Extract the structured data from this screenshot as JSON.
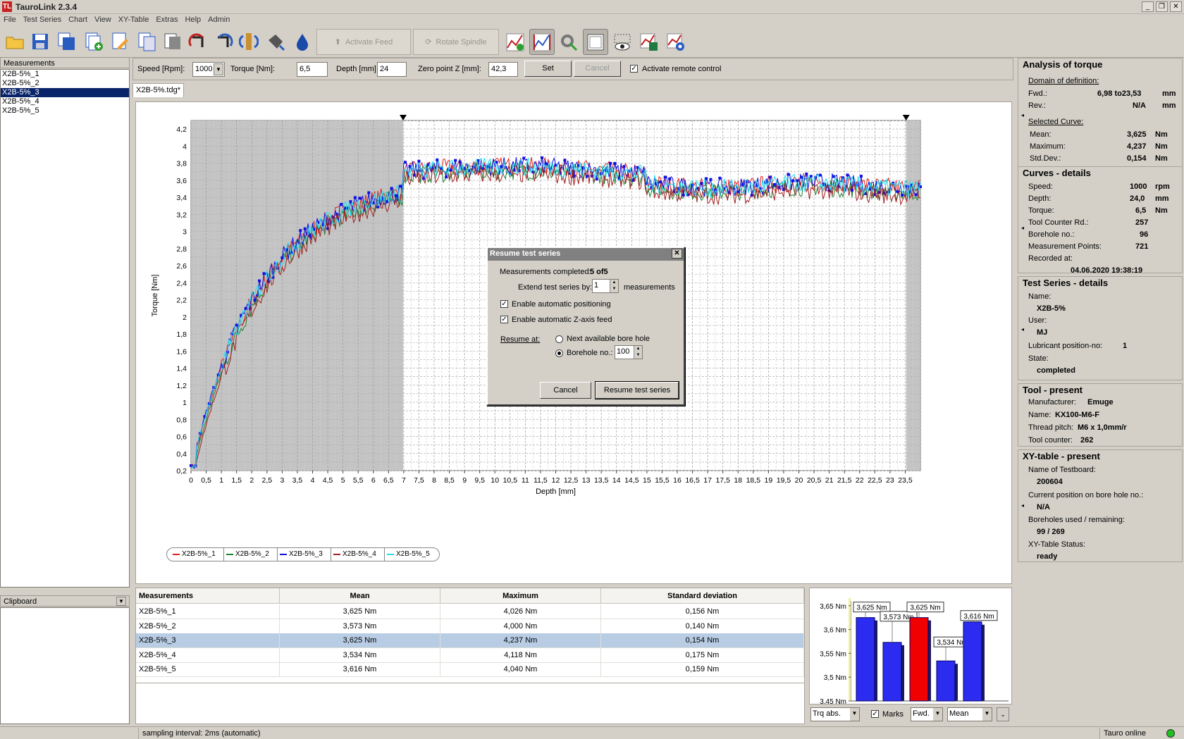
{
  "app": {
    "title": "TauroLink 2.3.4",
    "logo_text": "TL"
  },
  "menu": [
    "File",
    "Test Series",
    "Chart",
    "View",
    "XY-Table",
    "Extras",
    "Help",
    "Admin"
  ],
  "toolbar": {
    "activate_feed": "Activate Feed",
    "rotate_spindle": "Rotate Spindle"
  },
  "sidebar": {
    "measurements_header": "Measurements",
    "items": [
      "X2B-5%_1",
      "X2B-5%_2",
      "X2B-5%_3",
      "X2B-5%_4",
      "X2B-5%_5"
    ],
    "selected_index": 2,
    "clipboard_header": "Clipboard"
  },
  "params": {
    "speed_label": "Speed [Rpm]:",
    "speed_value": "1000",
    "torque_label": "Torque [Nm]:",
    "torque_value": "6,5",
    "depth_label": "Depth [mm]",
    "depth_value": "24",
    "zero_label": "Zero point Z [mm]:",
    "zero_value": "42,3",
    "set_label": "Set",
    "cancel_label": "Cancel",
    "remote_label": "Activate remote control",
    "remote_checked": true
  },
  "tab_label": "X2B-5%.tdg*",
  "chart_data": {
    "type": "line",
    "xlabel": "Depth [mm]",
    "ylabel": "Torque [Nm]",
    "xlim": [
      0,
      24
    ],
    "ylim": [
      0.2,
      4.3
    ],
    "x_ticks": [
      "0",
      "0,5",
      "1",
      "1,5",
      "2",
      "2,5",
      "3",
      "3,5",
      "4",
      "4,5",
      "5",
      "5,5",
      "6",
      "6,5",
      "7",
      "7,5",
      "8",
      "8,5",
      "9",
      "9,5",
      "10",
      "10,5",
      "11",
      "11,5",
      "12",
      "12,5",
      "13",
      "13,5",
      "14",
      "14,5",
      "15",
      "15,5",
      "16",
      "16,5",
      "17",
      "17,5",
      "18",
      "18,5",
      "19",
      "19,5",
      "20",
      "20,5",
      "21",
      "21,5",
      "22",
      "22,5",
      "23",
      "23,5"
    ],
    "y_ticks": [
      "0,2",
      "0,4",
      "0,6",
      "0,8",
      "1",
      "1,2",
      "1,4",
      "1,6",
      "1,8",
      "2",
      "2,2",
      "2,4",
      "2,6",
      "2,8",
      "3",
      "3,2",
      "3,4",
      "3,6",
      "3,8",
      "4",
      "4,2"
    ],
    "shaded_ranges": [
      [
        0,
        6.98
      ],
      [
        23.53,
        24
      ]
    ],
    "series": [
      {
        "name": "X2B-5%_1",
        "color": "#e02020",
        "mean": 3.625
      },
      {
        "name": "X2B-5%_2",
        "color": "#208030",
        "mean": 3.573
      },
      {
        "name": "X2B-5%_3",
        "color": "#1010e0",
        "mean": 3.625,
        "marks": true
      },
      {
        "name": "X2B-5%_4",
        "color": "#a02020",
        "mean": 3.534
      },
      {
        "name": "X2B-5%_5",
        "color": "#20e0f0",
        "mean": 3.616
      }
    ]
  },
  "dialog": {
    "title": "Resume test series",
    "completed_label": "Measurements completed:",
    "completed_value": "5 of5",
    "extend_label": "Extend test series by:",
    "extend_value": "1",
    "extend_unit": "measurements",
    "auto_pos_label": "Enable automatic positioning",
    "auto_z_label": "Enable automatic Z-axis feed",
    "resume_at_label": "Resume at:",
    "next_hole_label": "Next available bore hole",
    "borehole_label": "Borehole no.:",
    "borehole_value": "100",
    "cancel_label": "Cancel",
    "resume_label": "Resume test series"
  },
  "table": {
    "headers": [
      "Measurements",
      "Mean",
      "Maximum",
      "Standard deviation"
    ],
    "rows": [
      [
        "X2B-5%_1",
        "3,625 Nm",
        "4,026 Nm",
        "0,156 Nm"
      ],
      [
        "X2B-5%_2",
        "3,573 Nm",
        "4,000 Nm",
        "0,140 Nm"
      ],
      [
        "X2B-5%_3",
        "3,625 Nm",
        "4,237 Nm",
        "0,154 Nm"
      ],
      [
        "X2B-5%_4",
        "3,534 Nm",
        "4,118 Nm",
        "0,175 Nm"
      ],
      [
        "X2B-5%_5",
        "3,616 Nm",
        "4,040 Nm",
        "0,159 Nm"
      ]
    ],
    "selected_index": 2
  },
  "bar_chart": {
    "type": "bar",
    "categories": [
      "X2B-5%_1",
      "X2B-5%_2",
      "X2B-5%_3",
      "X2B-5%_4",
      "X2B-5%_5"
    ],
    "values": [
      3.625,
      3.573,
      3.625,
      3.534,
      3.616
    ],
    "labels": [
      "3,625 Nm",
      "3,573 Nm",
      "3,625 Nm",
      "3,534 Nm",
      "3,616 Nm"
    ],
    "highlight_index": 2,
    "ylim": [
      3.45,
      3.66
    ],
    "y_ticks": [
      "3,45 Nm",
      "3,5 Nm",
      "3,55 Nm",
      "3,6 Nm",
      "3,65 Nm"
    ],
    "bar_color": "#2c2cf0",
    "highlight_color": "#f00000"
  },
  "bar_controls": {
    "mode": "Trq abs.",
    "marks_label": "Marks",
    "direction": "Fwd.",
    "stat": "Mean"
  },
  "analysis": {
    "title": "Analysis of torque",
    "domain_label": "Domain of definition:",
    "fwd_label": "Fwd.:",
    "fwd_value": "6,98 to23,53",
    "fwd_unit": "mm",
    "rev_label": "Rev.:",
    "rev_value": "N/A",
    "rev_unit": "mm",
    "selected_label": "Selected Curve:",
    "mean_label": "Mean:",
    "mean_value": "3,625",
    "mean_unit": "Nm",
    "max_label": "Maximum:",
    "max_value": "4,237",
    "max_unit": "Nm",
    "std_label": "Std.Dev.:",
    "std_value": "0,154",
    "std_unit": "Nm"
  },
  "curves": {
    "title": "Curves - details",
    "speed_label": "Speed:",
    "speed_value": "1000",
    "speed_unit": "rpm",
    "depth_label": "Depth:",
    "depth_value": "24,0",
    "depth_unit": "mm",
    "torque_label": "Torque:",
    "torque_value": "6,5",
    "torque_unit": "Nm",
    "counter_label": "Tool Counter Rd.:",
    "counter_value": "257",
    "borehole_label": "Borehole no.:",
    "borehole_value": "96",
    "points_label": "Measurement Points:",
    "points_value": "721",
    "recorded_label": "Recorded at:",
    "recorded_value": "04.06.2020 19:38:19"
  },
  "testseries": {
    "title": "Test Series - details",
    "name_label": "Name:",
    "name_value": "X2B-5%",
    "user_label": "User:",
    "user_value": "MJ",
    "lub_label": "Lubricant position-no:",
    "lub_value": "1",
    "state_label": "State:",
    "state_value": "completed"
  },
  "tool": {
    "title": "Tool - present",
    "manu_label": "Manufacturer:",
    "manu_value": "Emuge",
    "name_label": "Name:",
    "name_value": "KX100-M6-F",
    "pitch_label": "Thread pitch:",
    "pitch_value": "M6 x  1,0mm/r",
    "counter_label": "Tool counter:",
    "counter_value": "262"
  },
  "xytable": {
    "title": "XY-table - present",
    "board_label": "Name of Testboard:",
    "board_value": "200604",
    "pos_label": "Current position on bore hole no.:",
    "pos_value": "N/A",
    "used_label": "Boreholes used / remaining:",
    "used_value": "99 / 269",
    "status_label": "XY-Table Status:",
    "status_value": "ready"
  },
  "status": {
    "left": "sampling interval: 2ms (automatic)",
    "right": "Tauro online",
    "online_color": "#20c020"
  }
}
